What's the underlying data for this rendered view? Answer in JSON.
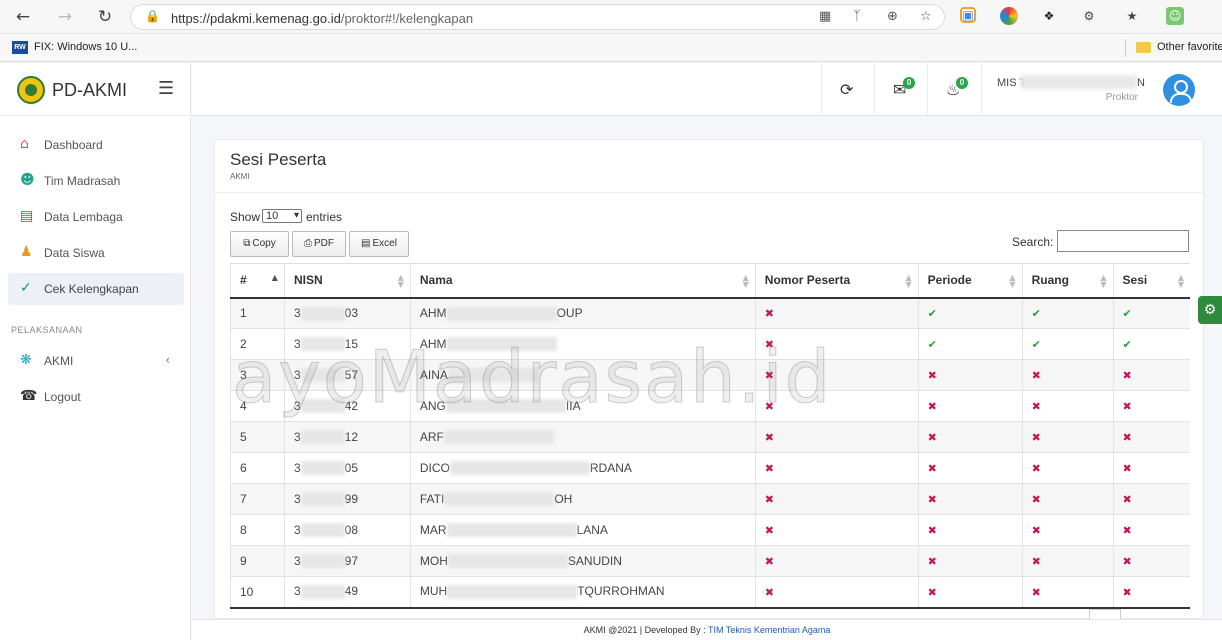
{
  "browser": {
    "url_host": "https://pdakmi.kemenag.go.id",
    "url_path": "/proktor#!/kelengkapan",
    "bookmark": "FIX: Windows 10 U...",
    "bookmark_favicon": "RW",
    "other_favorites": "Other favorite"
  },
  "sidebar": {
    "brand": "PD-AKMI",
    "items": [
      {
        "label": "Dashboard",
        "icon": "home-icon",
        "color": "#e55353"
      },
      {
        "label": "Tim Madrasah",
        "icon": "user-icon",
        "color": "#20a58f"
      },
      {
        "label": "Data Lembaga",
        "icon": "document-icon",
        "color": "#1c8e4a"
      },
      {
        "label": "Data Siswa",
        "icon": "users-icon",
        "color": "#e69b20"
      },
      {
        "label": "Cek Kelengkapan",
        "icon": "user-check-icon",
        "color": "#1c8e4a"
      }
    ],
    "section_header": "PELAKSANAAN",
    "section_items": [
      {
        "label": "AKMI",
        "icon": "settings-icon",
        "color": "#20a5c9"
      },
      {
        "label": "Logout",
        "icon": "headset-icon",
        "color": "#333333"
      }
    ]
  },
  "topbar": {
    "messages_count": "0",
    "notifications_count": "0",
    "user_name": "MIS T",
    "user_name_end": "N",
    "user_role": "Proktor"
  },
  "card": {
    "title": "Sesi Peserta",
    "subtitle": "AKMI",
    "show_label": "Show",
    "show_value": "10",
    "entries_label": "entries",
    "buttons": {
      "copy": "Copy",
      "pdf": "PDF",
      "excel": "Excel"
    },
    "search_label": "Search:"
  },
  "table": {
    "headers": [
      "#",
      "NISN",
      "Nama",
      "Nomor Peserta",
      "Periode",
      "Ruang",
      "Sesi"
    ],
    "rows": [
      {
        "no": "1",
        "nisn_start": "3",
        "nisn_end": "03",
        "nama_start": "AHM",
        "nama_end": "OUP",
        "nomor": false,
        "periode": true,
        "ruang": true,
        "sesi": true
      },
      {
        "no": "2",
        "nisn_start": "3",
        "nisn_end": "15",
        "nama_start": "AHM",
        "nama_end": "",
        "nomor": false,
        "periode": true,
        "ruang": true,
        "sesi": true
      },
      {
        "no": "3",
        "nisn_start": "3",
        "nisn_end": "57",
        "nama_start": "AINA",
        "nama_end": "",
        "nomor": false,
        "periode": false,
        "ruang": false,
        "sesi": false
      },
      {
        "no": "4",
        "nisn_start": "3",
        "nisn_end": "42",
        "nama_start": "ANG",
        "nama_end": "IIA",
        "nomor": false,
        "periode": false,
        "ruang": false,
        "sesi": false
      },
      {
        "no": "5",
        "nisn_start": "3",
        "nisn_end": "12",
        "nama_start": "ARF",
        "nama_end": "",
        "nomor": false,
        "periode": false,
        "ruang": false,
        "sesi": false
      },
      {
        "no": "6",
        "nisn_start": "3",
        "nisn_end": "05",
        "nama_start": "DICO",
        "nama_end": "RDANA",
        "nomor": false,
        "periode": false,
        "ruang": false,
        "sesi": false
      },
      {
        "no": "7",
        "nisn_start": "3",
        "nisn_end": "99",
        "nama_start": "FATI",
        "nama_end": "OH",
        "nomor": false,
        "periode": false,
        "ruang": false,
        "sesi": false
      },
      {
        "no": "8",
        "nisn_start": "3",
        "nisn_end": "08",
        "nama_start": "MAR",
        "nama_end": "LANA",
        "nomor": false,
        "periode": false,
        "ruang": false,
        "sesi": false
      },
      {
        "no": "9",
        "nisn_start": "3",
        "nisn_end": "97",
        "nama_start": "MOH",
        "nama_end": "SANUDIN",
        "nomor": false,
        "periode": false,
        "ruang": false,
        "sesi": false
      },
      {
        "no": "10",
        "nisn_start": "3",
        "nisn_end": "49",
        "nama_start": "MUH",
        "nama_end": "TQURROHMAN",
        "nomor": false,
        "periode": false,
        "ruang": false,
        "sesi": false
      }
    ]
  },
  "watermark": "ayoMadrasah.id",
  "footer": {
    "text": "AKMI @2021 | Developed By : ",
    "link": "TIM Teknis Kementrian Agama"
  },
  "colors": {
    "check": "#2e9e3e",
    "cross": "#c2185b",
    "accent_green": "#2e8b3e",
    "avatar": "#2f8fe0"
  }
}
